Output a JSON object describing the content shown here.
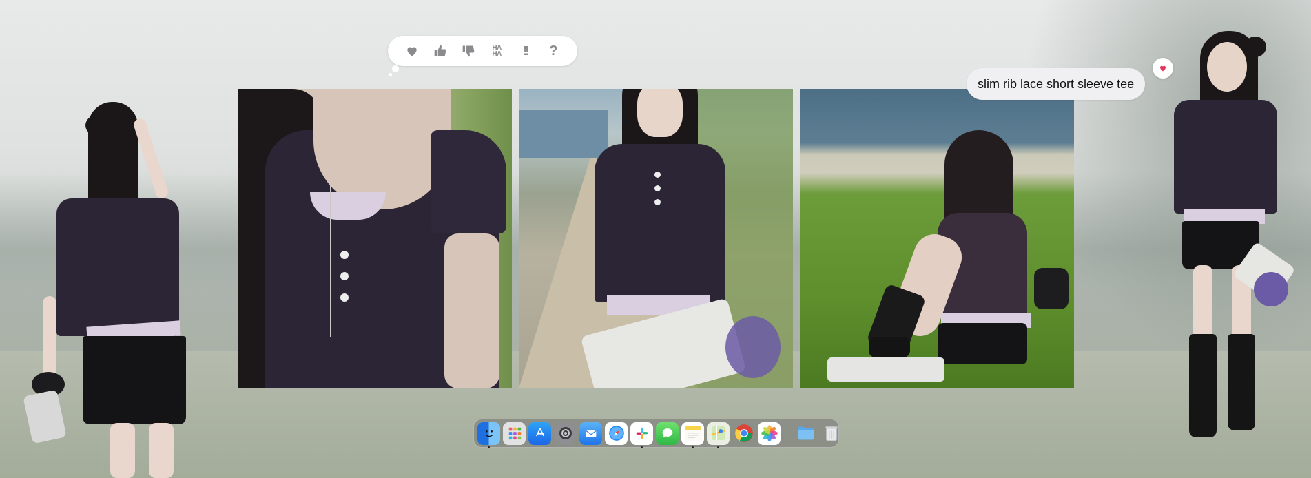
{
  "reactions": {
    "items": [
      {
        "name": "heart",
        "glyph": ""
      },
      {
        "name": "thumbs-up",
        "glyph": ""
      },
      {
        "name": "thumbs-down",
        "glyph": ""
      },
      {
        "name": "haha",
        "glyph": "HA HA"
      },
      {
        "name": "exclamation",
        "glyph": "!!"
      },
      {
        "name": "question",
        "glyph": "?"
      }
    ],
    "haha_label": "HA HA",
    "exclaim_label": "!!",
    "question_label": "?"
  },
  "message": {
    "text": "slim rib lace short sleeve tee",
    "reaction": "heart-icon",
    "reaction_color": "#e5375a"
  },
  "dock": {
    "apps": [
      {
        "name": "finder",
        "color": "#2f8cf0"
      },
      {
        "name": "launchpad",
        "color": "#d9d9db"
      },
      {
        "name": "app-store",
        "color": "#1f7ef0"
      },
      {
        "name": "system-settings",
        "color": "#8a8a8e"
      },
      {
        "name": "mail",
        "color": "#3b8fe8"
      },
      {
        "name": "safari",
        "color": "#2a84e8"
      },
      {
        "name": "slack",
        "color": "#ffffff"
      },
      {
        "name": "messages",
        "color": "#3ec24d"
      },
      {
        "name": "notes",
        "color": "#f7d95a"
      },
      {
        "name": "maps",
        "color": "#6fbf63"
      },
      {
        "name": "chrome",
        "color": "#ffffff"
      },
      {
        "name": "photos",
        "color": "#ffffff"
      },
      {
        "name": "folder",
        "color": "#5aa8e8"
      },
      {
        "name": "trash",
        "color": "#d3d6d8"
      }
    ]
  },
  "photos": [
    {
      "name": "photo-closeup-neckline"
    },
    {
      "name": "photo-front-full"
    },
    {
      "name": "photo-sitting-grass"
    }
  ],
  "colors": {
    "tee": "#2b2535",
    "lace_trim": "#d9cfe0",
    "bubble": "#f0f0f2"
  }
}
